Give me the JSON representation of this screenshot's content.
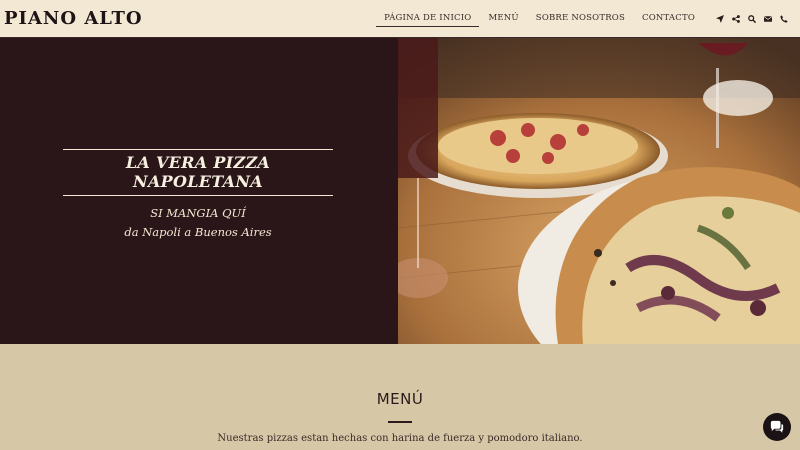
{
  "header": {
    "logo": "PIANO ALTO",
    "nav": [
      {
        "label": "PÁGINA DE INICIO",
        "active": true
      },
      {
        "label": "MENÚ",
        "active": false
      },
      {
        "label": "SOBRE NOSOTROS",
        "active": false
      },
      {
        "label": "CONTACTO",
        "active": false
      }
    ],
    "icons": [
      "location-arrow-icon",
      "share-icon",
      "search-icon",
      "mail-icon",
      "phone-icon"
    ]
  },
  "hero": {
    "title": "LA VERA PIZZA NAPOLETANA",
    "subtitle_line1": "SI MANGIA QUÍ",
    "subtitle_line2": "da Napoli a Buenos Aires"
  },
  "menu_section": {
    "title": "MENÚ",
    "description": "Nuestras pizzas estan hechas con harina de fuerza y pomodoro italiano."
  },
  "chat": {
    "icon": "chat-icon"
  },
  "colors": {
    "header_bg": "#f2e8d3",
    "hero_dark": "#2a1618",
    "menu_bg": "#d6c8a6",
    "text_dark": "#2a1a1c"
  }
}
